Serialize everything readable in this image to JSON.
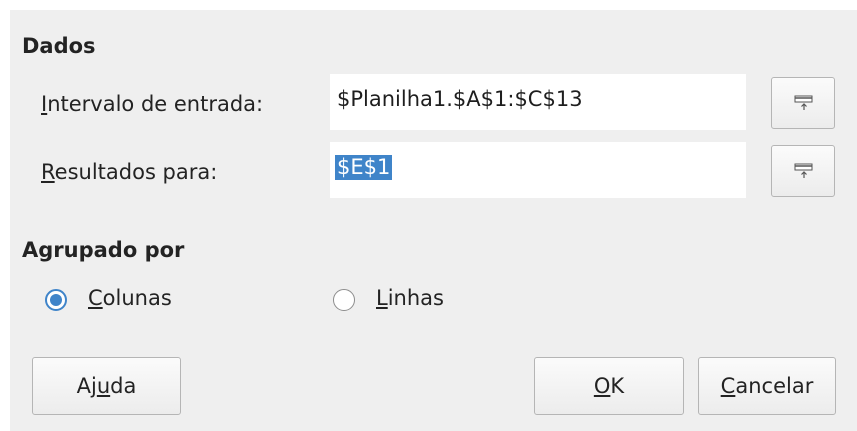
{
  "dados": {
    "title": "Dados",
    "input_range": {
      "label_mnemonic": "I",
      "label_rest": "ntervalo de entrada:",
      "value": "$Planilha1.$A$1:$C$13"
    },
    "results_to": {
      "label_mnemonic": "R",
      "label_rest": "esultados para:",
      "value": "$E$1"
    },
    "shrink_icon": "shrink-dialog-icon"
  },
  "grouped_by": {
    "title": "Agrupado por",
    "columns": {
      "label_mnemonic": "C",
      "label_rest": "olunas",
      "checked": true
    },
    "rows": {
      "label_mnemonic": "L",
      "label_rest": "inhas",
      "checked": false
    }
  },
  "buttons": {
    "help": {
      "pre": "Aj",
      "mnemonic": "u",
      "post": "da"
    },
    "ok": {
      "pre": "",
      "mnemonic": "O",
      "post": "K"
    },
    "cancel": {
      "pre": "",
      "mnemonic": "C",
      "post": "ancelar"
    }
  },
  "colors": {
    "accent": "#3f84c9",
    "dialog_bg": "#efefef"
  }
}
